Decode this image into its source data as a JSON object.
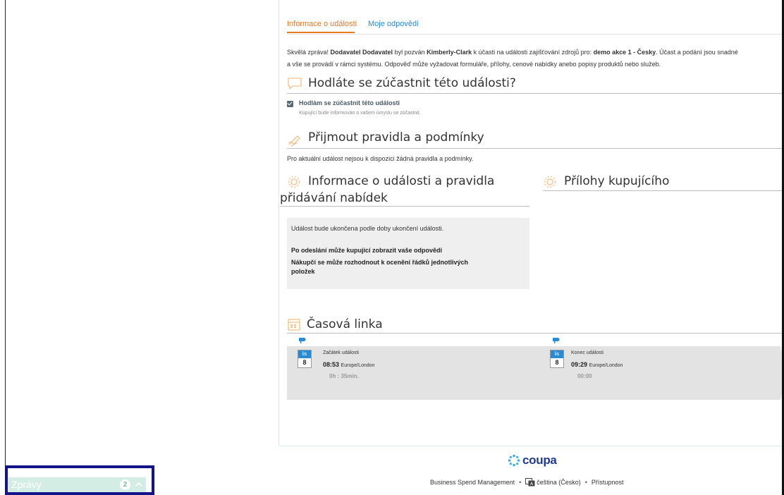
{
  "tabs": [
    {
      "label": "Informace o události",
      "active": true
    },
    {
      "label": "Moje odpovědi",
      "active": false
    }
  ],
  "intro": {
    "p1": "Skvělá zpráva! ",
    "supplier": "Dodavatel Dodavatel",
    "p2": " byl pozván ",
    "buyer": "Kimberly-Clark",
    "p3": " k účasti na události zajišťování zdrojů pro: ",
    "event": "demo akce 1 - Česky",
    "p4": ". Účast a podání jsou snadné",
    "line2": "a vše se provádí v rámci systému. Odpověď může vyžadovat formuláře, přílohy, cenové nabídky anebo popisy produktů nebo služeb."
  },
  "participate": {
    "title": "Hodláte se zúčastnit této události?",
    "checkbox_label": "Hodlám se zúčastnit této události",
    "help": "Kupující bude informován o vašem úmyslu se zúčastnit.",
    "checked": true
  },
  "rules": {
    "title": "Přijmout pravidla a podmínky",
    "text": "Pro aktuální událost nejsou k dispozici žádná pravidla a podmínky."
  },
  "event_info": {
    "title_line1": "Informace o události a pravidla",
    "title_line2": "přidávání nabídek",
    "end_note": "Událost bude ukončena podle doby ukončení události.",
    "bold1": "Po odeslání může kupující zobrazit vaše odpovědi",
    "bold2": "Nákupčí se může rozhodnout k ocenění řádků jednotlivých",
    "bold3": "položek"
  },
  "attachments": {
    "title": "Přílohy kupujícího"
  },
  "timeline": {
    "title": "Časová linka",
    "start": {
      "month": "lis",
      "day": "8",
      "label": "Začátek události",
      "time": "08:53",
      "tz": "Europe/London",
      "duration": "0h : 35min."
    },
    "end": {
      "month": "lis",
      "day": "8",
      "label": "Konec události",
      "time": "09:29",
      "tz": "Europe/London",
      "duration": "00:00"
    }
  },
  "footer": {
    "logo": "coupa",
    "bsm": "Business Spend Management",
    "language": "čeština (Česko)",
    "accessibility": "Přístupnost",
    "separator": "•"
  },
  "messages": {
    "label": "Zprávy",
    "count": "2"
  },
  "colors": {
    "accent_orange": "#e87722",
    "link_blue": "#2a8bd4",
    "coupa_blue": "#1f3a8f",
    "messages_green": "#d4ede4",
    "highlight_border": "#14148a"
  }
}
